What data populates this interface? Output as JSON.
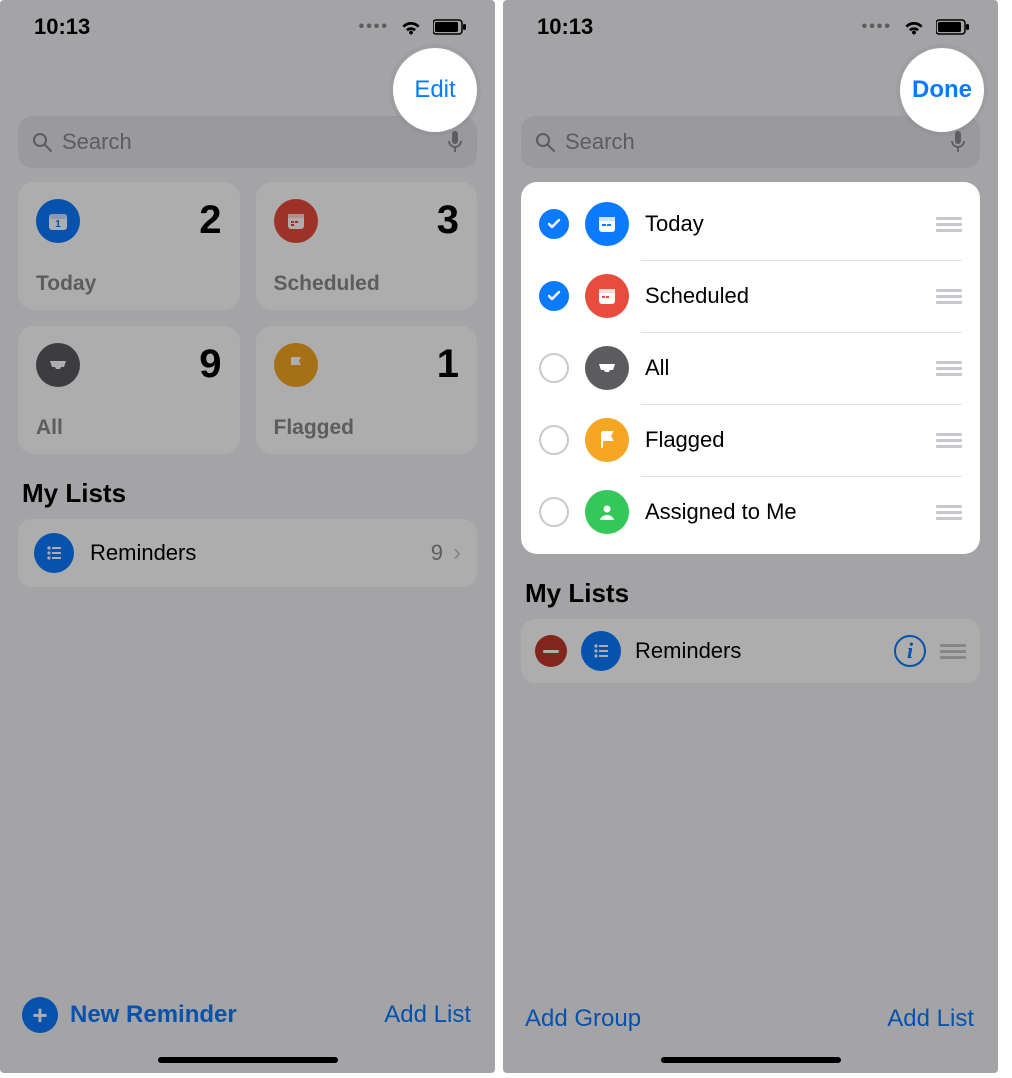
{
  "status": {
    "time": "10:13"
  },
  "left": {
    "top_action": "Edit",
    "search_placeholder": "Search",
    "cards": {
      "today": {
        "label": "Today",
        "count": "2"
      },
      "scheduled": {
        "label": "Scheduled",
        "count": "3"
      },
      "all": {
        "label": "All",
        "count": "9"
      },
      "flagged": {
        "label": "Flagged",
        "count": "1"
      }
    },
    "my_lists_title": "My Lists",
    "lists": {
      "reminders": {
        "name": "Reminders",
        "count": "9"
      }
    },
    "bottom": {
      "new_reminder": "New Reminder",
      "add_list": "Add List"
    }
  },
  "right": {
    "top_action": "Done",
    "search_placeholder": "Search",
    "smart_lists": [
      {
        "key": "today",
        "label": "Today",
        "checked": true
      },
      {
        "key": "scheduled",
        "label": "Scheduled",
        "checked": true
      },
      {
        "key": "all",
        "label": "All",
        "checked": false
      },
      {
        "key": "flagged",
        "label": "Flagged",
        "checked": false
      },
      {
        "key": "assigned",
        "label": "Assigned to Me",
        "checked": false
      }
    ],
    "my_lists_title": "My Lists",
    "lists": {
      "reminders": {
        "name": "Reminders"
      }
    },
    "bottom": {
      "add_group": "Add Group",
      "add_list": "Add List"
    }
  }
}
